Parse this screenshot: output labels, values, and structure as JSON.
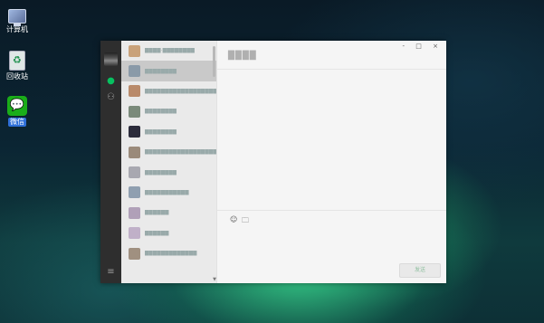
{
  "desktop": {
    "icons": [
      {
        "label": "计算机",
        "icon": "computer-icon"
      },
      {
        "label": "回收站",
        "icon": "recycle-bin-icon"
      },
      {
        "label": "微信",
        "icon": "wechat-icon"
      }
    ]
  },
  "window": {
    "controls": "- □ ×",
    "nav": {
      "chat_icon": "chat-icon",
      "contacts_icon": "contacts-icon",
      "menu_icon": "menu-icon"
    },
    "chat_list": [
      {
        "name": "████·████████",
        "active": false,
        "color": "#c9a27a"
      },
      {
        "name": "████████",
        "active": true,
        "color": "#8a9aa8"
      },
      {
        "name": "███████████████████",
        "active": false,
        "color": "#b98a6a"
      },
      {
        "name": "████████",
        "active": false,
        "color": "#7a8a7a"
      },
      {
        "name": "████████",
        "active": false,
        "color": "#2b2b3a"
      },
      {
        "name": "██████████████████",
        "active": false,
        "color": "#9a8a7a"
      },
      {
        "name": "████████",
        "active": false,
        "color": "#a8a8b0"
      },
      {
        "name": "███████████",
        "active": false,
        "color": "#8f9fb0"
      },
      {
        "name": "██████",
        "active": false,
        "color": "#b0a0b8"
      },
      {
        "name": "██████",
        "active": false,
        "color": "#c0b0c8"
      },
      {
        "name": "█████████████",
        "active": false,
        "color": "#a09080"
      }
    ],
    "conversation_title": "████",
    "toolbar": {
      "emoji_icon": "☺",
      "folder_icon": "🗀"
    },
    "send_label": "发送"
  }
}
